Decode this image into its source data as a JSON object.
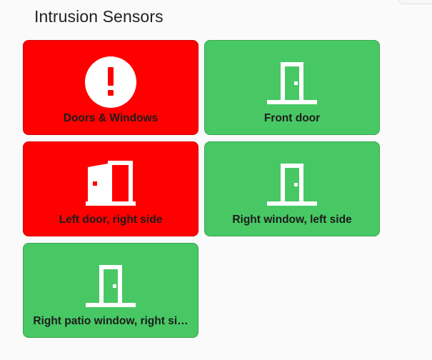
{
  "header": {
    "title": "Intrusion Sensors"
  },
  "colors": {
    "alarm": "#ff0000",
    "ok": "#48c864",
    "icon": "#ffffff"
  },
  "tiles": [
    {
      "label": "Doors & Windows",
      "state": "alarm",
      "icon": "alert-circle-icon"
    },
    {
      "label": "Front door",
      "state": "ok",
      "icon": "door-closed-icon"
    },
    {
      "label": "Left door, right side",
      "state": "alarm",
      "icon": "door-open-icon"
    },
    {
      "label": "Right window, left side",
      "state": "ok",
      "icon": "door-closed-icon"
    },
    {
      "label": "Right patio window, right si…",
      "state": "ok",
      "icon": "door-closed-icon"
    }
  ]
}
